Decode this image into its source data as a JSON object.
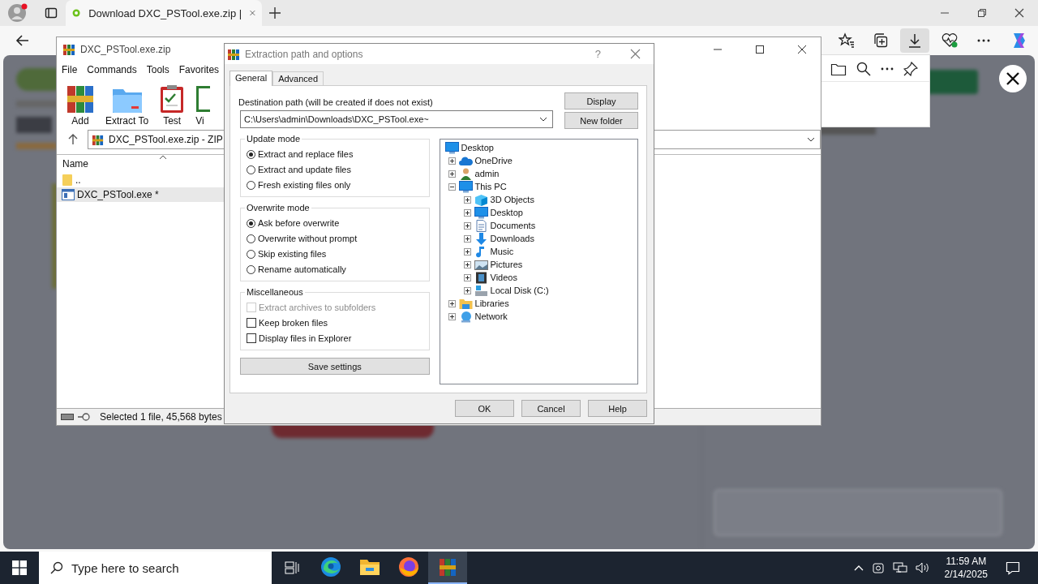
{
  "browser": {
    "tab_title": "Download DXC_PSTool.exe.zip |"
  },
  "winrar": {
    "title": "DXC_PSTool.exe.zip",
    "menu": [
      "File",
      "Commands",
      "Tools",
      "Favorites"
    ],
    "toolbar": [
      {
        "label": "Add",
        "kind": "books"
      },
      {
        "label": "Extract To",
        "kind": "folder"
      },
      {
        "label": "Test",
        "kind": "clipboard"
      },
      {
        "label": "Vi",
        "kind": "book"
      }
    ],
    "address": "DXC_PSTool.exe.zip - ZIP",
    "column": "Name",
    "files": [
      {
        "name": "..",
        "kind": "folder",
        "selected": false
      },
      {
        "name": "DXC_PSTool.exe *",
        "kind": "exe",
        "selected": true
      }
    ],
    "status": "Selected 1 file, 45,568 bytes"
  },
  "dialog": {
    "title": "Extraction path and options",
    "help": "?",
    "tabs": [
      {
        "label": "General",
        "selected": true
      },
      {
        "label": "Advanced",
        "selected": false
      }
    ],
    "destination_label": "Destination path (will be created if does not exist)",
    "destination_value": "C:\\Users\\admin\\Downloads\\DXC_PSTool.exe~",
    "side_buttons": [
      "Display",
      "New folder"
    ],
    "update_mode": {
      "title": "Update mode",
      "options": [
        {
          "label": "Extract and replace files",
          "selected": true
        },
        {
          "label": "Extract and update files",
          "selected": false
        },
        {
          "label": "Fresh existing files only",
          "selected": false
        }
      ]
    },
    "overwrite_mode": {
      "title": "Overwrite mode",
      "options": [
        {
          "label": "Ask before overwrite",
          "selected": true
        },
        {
          "label": "Overwrite without prompt",
          "selected": false
        },
        {
          "label": "Skip existing files",
          "selected": false
        },
        {
          "label": "Rename automatically",
          "selected": false
        }
      ]
    },
    "miscellaneous": {
      "title": "Miscellaneous",
      "options": [
        {
          "label": "Extract archives to subfolders",
          "checked": false,
          "disabled": true
        },
        {
          "label": "Keep broken files",
          "checked": false,
          "disabled": false
        },
        {
          "label": "Display files in Explorer",
          "checked": false,
          "disabled": false
        }
      ]
    },
    "save_button": "Save settings",
    "tree": [
      {
        "label": "Desktop",
        "kind": "monitor",
        "children": [
          {
            "label": "OneDrive",
            "kind": "cloud",
            "expanded": false
          },
          {
            "label": "admin",
            "kind": "user",
            "expanded": false
          },
          {
            "label": "This PC",
            "kind": "computer",
            "expanded": true,
            "children": [
              {
                "label": "3D Objects",
                "kind": "cube",
                "expanded": false
              },
              {
                "label": "Desktop",
                "kind": "monitor",
                "expanded": false
              },
              {
                "label": "Documents",
                "kind": "document",
                "expanded": false
              },
              {
                "label": "Downloads",
                "kind": "download",
                "expanded": false
              },
              {
                "label": "Music",
                "kind": "music",
                "expanded": false
              },
              {
                "label": "Pictures",
                "kind": "image",
                "expanded": false
              },
              {
                "label": "Videos",
                "kind": "film",
                "expanded": false
              },
              {
                "label": "Local Disk (C:)",
                "kind": "drive",
                "expanded": false
              }
            ]
          },
          {
            "label": "Libraries",
            "kind": "folder",
            "expanded": false
          },
          {
            "label": "Network",
            "kind": "network",
            "expanded": false
          }
        ]
      }
    ],
    "buttons": [
      "OK",
      "Cancel",
      "Help"
    ]
  },
  "taskbar": {
    "search_placeholder": "Type here to search",
    "apps": [
      {
        "kind": "edge",
        "active": false
      },
      {
        "kind": "explorer",
        "active": false
      },
      {
        "kind": "firefox",
        "active": false
      },
      {
        "kind": "winrar",
        "active": true
      }
    ],
    "time": "11:59 AM",
    "date": "2/14/2025"
  }
}
